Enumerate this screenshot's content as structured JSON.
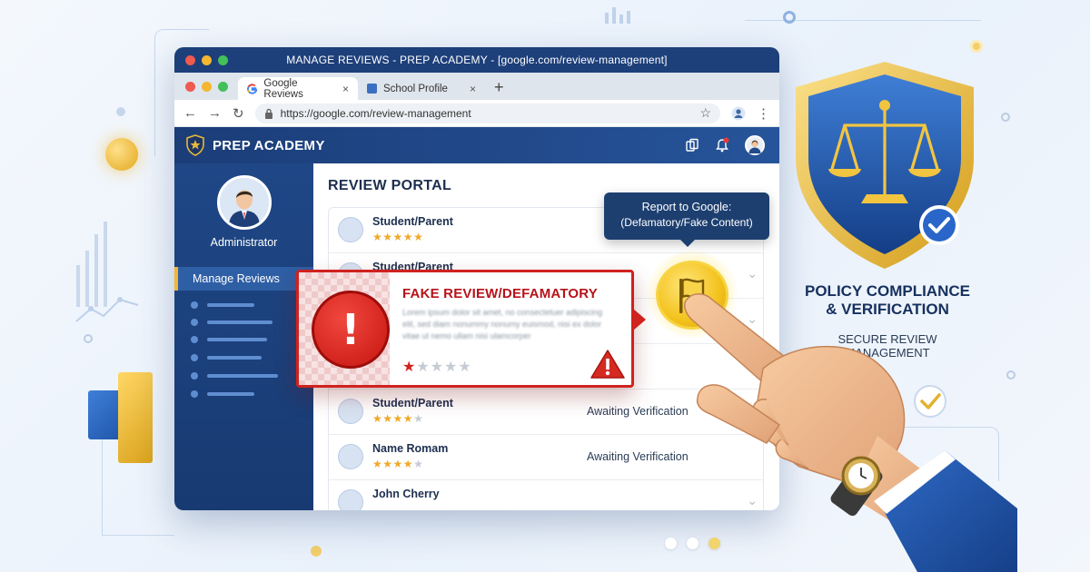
{
  "window": {
    "title": "MANAGE REVIEWS - PREP ACADEMY - [google.com/review-management]"
  },
  "tabs": [
    {
      "label": "Google Reviews",
      "close": "×"
    },
    {
      "label": "School Profile",
      "close": "×"
    }
  ],
  "new_tab_symbol": "+",
  "address_bar": {
    "url": "https://google.com/review-management"
  },
  "app": {
    "brand": "PREP ACADEMY",
    "notification_count": ""
  },
  "sidebar": {
    "user_role": "Administrator",
    "active_item": "Manage Reviews"
  },
  "portal": {
    "title": "REVIEW PORTAL",
    "reviews": [
      {
        "name": "Student/Parent",
        "rating": 5,
        "status": ""
      },
      {
        "name": "Student/Parent",
        "rating": 4,
        "status": ""
      },
      {
        "name": "",
        "rating": 0,
        "status": ""
      },
      {
        "name": "",
        "rating": 0,
        "status": ""
      },
      {
        "name": "Student/Parent",
        "rating": 4,
        "status": "Awaiting Verification"
      },
      {
        "name": "Name Romam",
        "rating": 4,
        "status": "Awaiting Verification"
      },
      {
        "name": "John Cherry",
        "rating": 0,
        "status": ""
      }
    ]
  },
  "tooltip": {
    "line1": "Report to Google:",
    "line2": "(Defamatory/Fake Content)"
  },
  "alert": {
    "title": "FAKE REVIEW/DEFAMATORY",
    "body": "Lorem ipsum dolor sit amet, no consectetuer adipiscing elit, sed diam nonummy nonumy euismod, nisi ex dolor vitae ut nemo ullam nisi ulamcorper",
    "rating": 1,
    "icon": "exclamation-icon"
  },
  "policy": {
    "title_line1": "POLICY COMPLIANCE",
    "title_line2": "& VERIFICATION",
    "sub_line1": "SECURE REVIEW",
    "sub_line2": "MANAGEMENT"
  },
  "colors": {
    "navy": "#1d3f7a",
    "alert_red": "#d0221e",
    "gold": "#f3c21c",
    "star": "#f0a92a"
  }
}
